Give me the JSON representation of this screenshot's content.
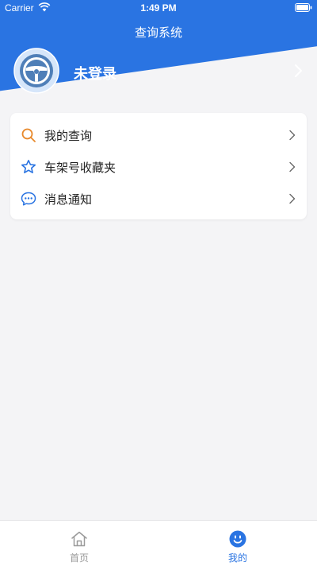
{
  "status_bar": {
    "carrier": "Carrier",
    "time": "1:49 PM"
  },
  "nav": {
    "title": "查询系统"
  },
  "profile": {
    "login_text": "未登录",
    "avatar_icon": "steering-wheel-icon"
  },
  "menu": {
    "items": [
      {
        "label": "我的查询",
        "icon": "search-icon",
        "color": "#e8892b"
      },
      {
        "label": "车架号收藏夹",
        "icon": "star-icon",
        "color": "#2a74e2"
      },
      {
        "label": "消息通知",
        "icon": "message-icon",
        "color": "#2a74e2"
      }
    ]
  },
  "tabbar": {
    "tabs": [
      {
        "label": "首页",
        "icon": "home-icon",
        "active": false
      },
      {
        "label": "我的",
        "icon": "smiley-icon",
        "active": true
      }
    ]
  },
  "colors": {
    "brand": "#2a74e2",
    "background": "#f4f4f6",
    "inactive": "#9a9a9a"
  }
}
